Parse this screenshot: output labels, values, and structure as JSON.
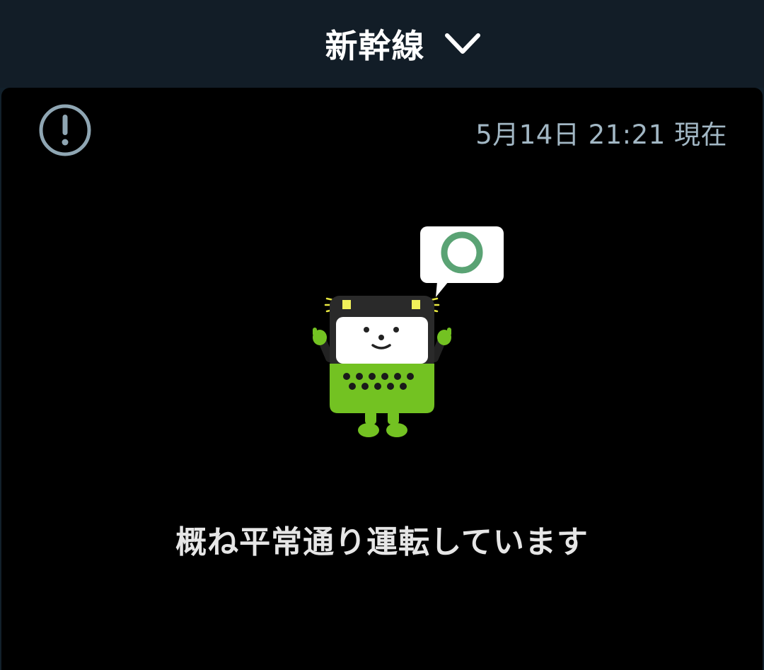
{
  "header": {
    "title": "新幹線",
    "dropdown_icon": "chevron-down-icon"
  },
  "status_panel": {
    "alert_icon": "exclamation-circle-icon",
    "timestamp": "5月14日 21:21 現在",
    "mascot_symbol": "○",
    "mascot_symbol_color": "#5aa374",
    "mascot_body_color": "#73c222",
    "message": "概ね平常通り運転しています"
  },
  "colors": {
    "header_bg": "#121d27",
    "panel_bg": "#000000",
    "timestamp_text": "#a2b7c4",
    "message_text": "#e6e6e6"
  }
}
